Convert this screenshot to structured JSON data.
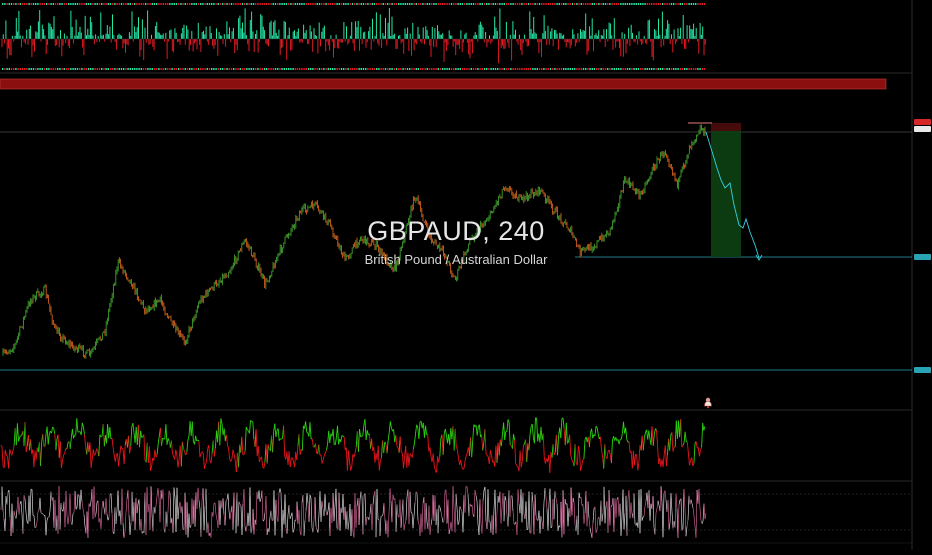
{
  "symbol": {
    "title": "GBPAUD, 240",
    "subtitle": "British Pound / Australian Dollar"
  },
  "colors": {
    "background": "#000000",
    "candle_up": "#3fa02e",
    "candle_down": "#d3621e",
    "histogram_up": "#26e6a6",
    "histogram_down": "#e11a22",
    "rsi_up": "#29d20f",
    "rsi_down": "#e7151b",
    "banner": "#8b0f0f",
    "support_line": "#2aa3b5",
    "target_box": "#0d3d12",
    "stop_box": "#4a0d0d",
    "forecast_path": "#36d1e2"
  },
  "icons": {
    "alert": "bell-icon"
  }
}
